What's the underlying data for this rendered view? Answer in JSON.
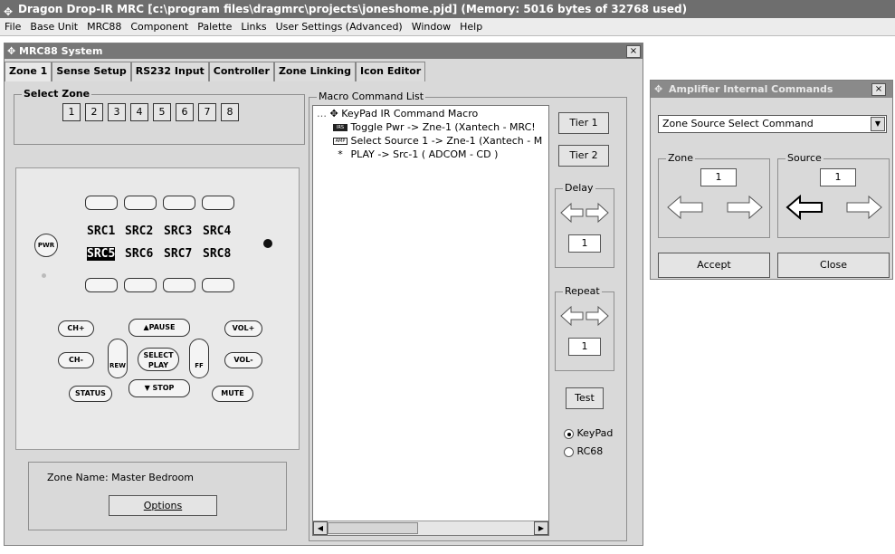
{
  "app": {
    "title": "Dragon Drop-IR MRC [c:\\program files\\dragmrc\\projects\\joneshome.pjd] (Memory: 5016 bytes of 32768 used)"
  },
  "menu": [
    "File",
    "Base Unit",
    "MRC88",
    "Component",
    "Palette",
    "Links",
    "User Settings (Advanced)",
    "Window",
    "Help"
  ],
  "mrc_window": {
    "title": "MRC88 System",
    "close": "×",
    "tabs": [
      "Zone 1",
      "Sense Setup",
      "RS232 Input",
      "Controller",
      "Zone Linking",
      "Icon Editor"
    ],
    "select_zone_label": "Select Zone",
    "zones": [
      "1",
      "2",
      "3",
      "4",
      "5",
      "6",
      "7",
      "8"
    ],
    "remote": {
      "pwr": "PWR",
      "lcd_row1": [
        "SRC1",
        "SRC2",
        "SRC3",
        "SRC4"
      ],
      "lcd_row2": [
        "SRC5",
        "SRC6",
        "SRC7",
        "SRC8"
      ],
      "ch_up": "CH+",
      "ch_down": "CH-",
      "pause": "▲PAUSE",
      "stop": "▼ STOP",
      "vol_up": "VOL+",
      "vol_down": "VOL-",
      "rew": "REW",
      "ff": "FF",
      "select_play": "SELECT PLAY",
      "status": "STATUS",
      "mute": "MUTE"
    },
    "zone_name": "Zone Name: Master Bedroom",
    "options_button": "Options",
    "macro_label": "Macro Command List",
    "macro_tree": {
      "root": "KeyPad IR Command Macro",
      "items": [
        {
          "badge": "IRS",
          "text": "Toggle Pwr -> Zne-1 (Xantech - MRC!"
        },
        {
          "badge": "AMP",
          "text": "Select Source 1 -> Zne-1 (Xantech - M"
        },
        {
          "badge": "*",
          "text": "PLAY -> Src-1 ( ADCOM - CD )"
        }
      ]
    },
    "tier1": "Tier 1",
    "tier2": "Tier 2",
    "delay_label": "Delay",
    "delay_value": "1",
    "repeat_label": "Repeat",
    "repeat_value": "1",
    "test_button": "Test",
    "radio_keypad": "KeyPad",
    "radio_rc68": "RC68",
    "radio_selected": "KeyPad"
  },
  "amp_window": {
    "title": "Amplifier Internal Commands",
    "close": "×",
    "dropdown_value": "Zone Source Select Command",
    "zone_label": "Zone",
    "zone_value": "1",
    "source_label": "Source",
    "source_value": "1",
    "accept_button": "Accept",
    "close_button": "Close"
  }
}
